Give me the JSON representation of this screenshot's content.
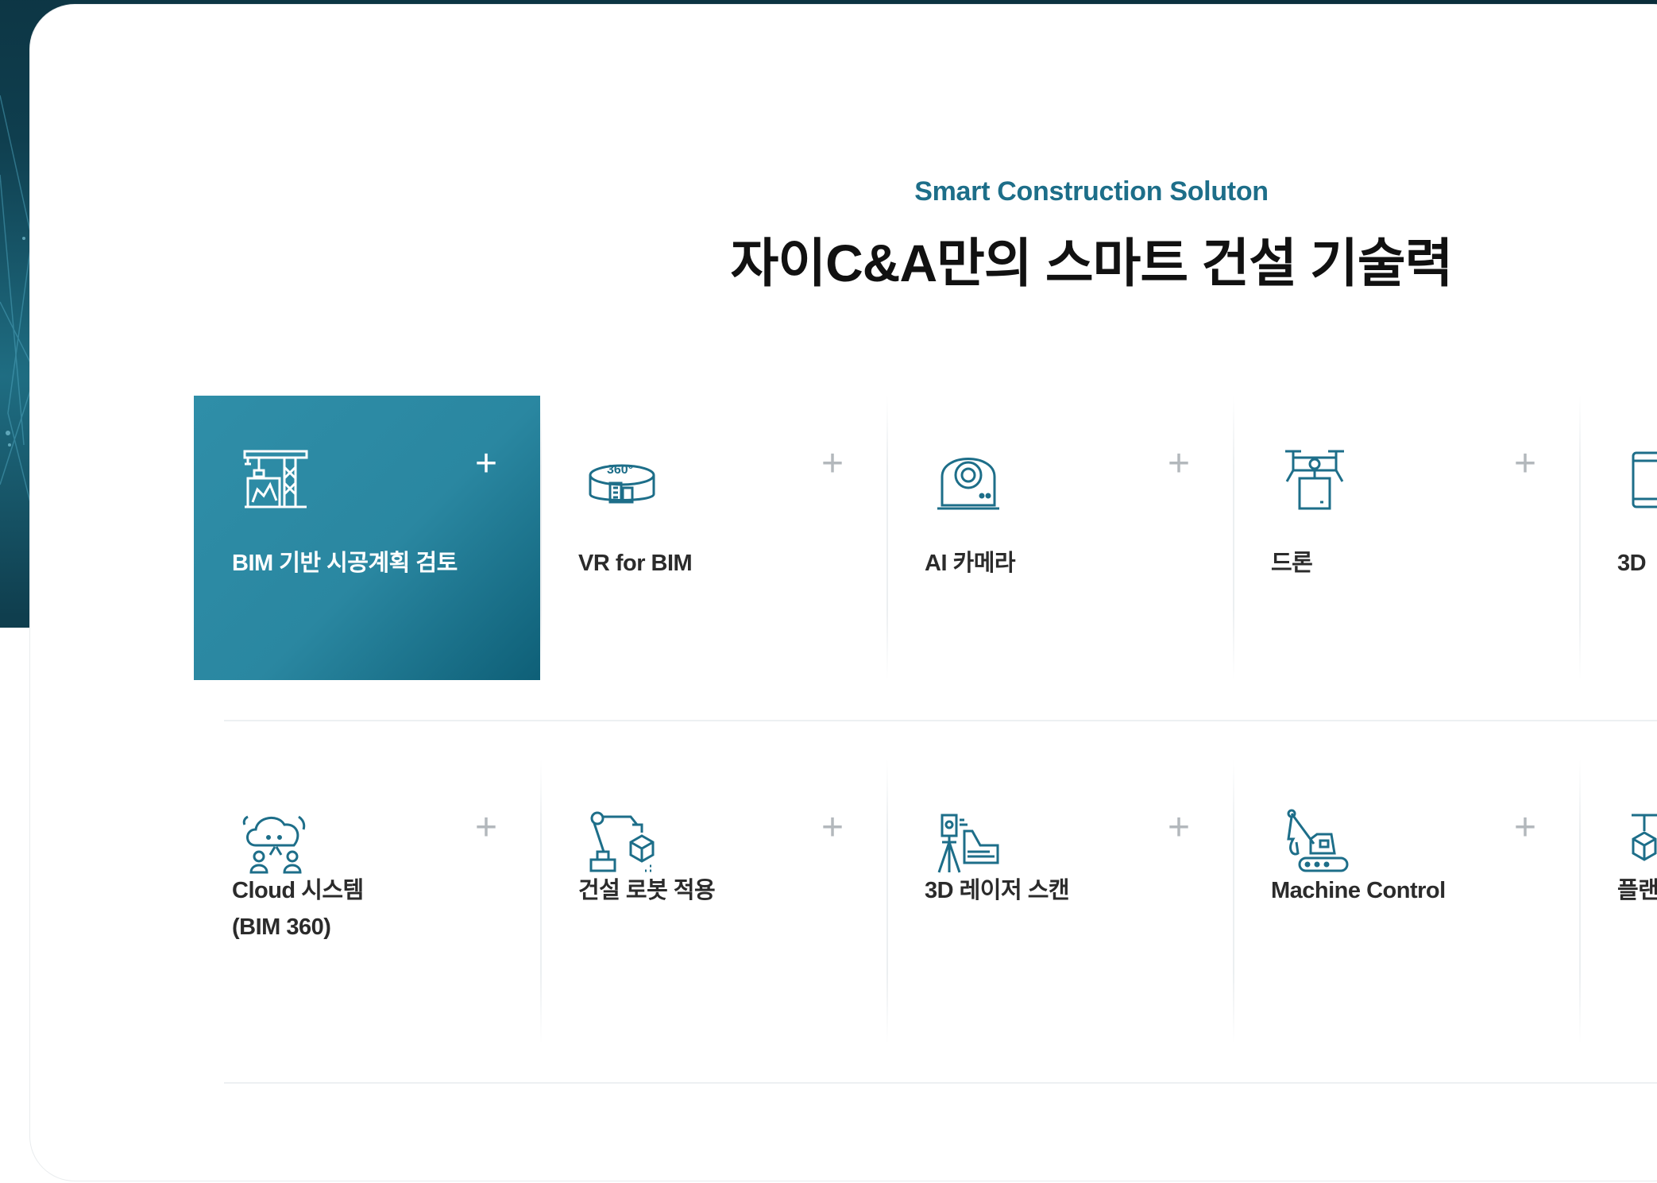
{
  "header": {
    "subtitle": "Smart Construction Soluton",
    "title": "자이C&A만의 스마트 건설 기술력"
  },
  "colors": {
    "accent": "#1d6e89",
    "active_card": "#2a87a1",
    "backdrop": "#0f3e4e"
  },
  "cards": [
    {
      "label": "BIM 기반 시공계획 검토",
      "icon": "crane-icon",
      "active": true
    },
    {
      "label": "VR for BIM",
      "icon": "vr-360-icon",
      "active": false
    },
    {
      "label": "AI 카메라",
      "icon": "camera-icon",
      "active": false
    },
    {
      "label": "드론",
      "icon": "drone-icon",
      "active": false
    },
    {
      "label": "3D",
      "icon": "tablet-icon",
      "active": false
    },
    {
      "label": "Cloud 시스템\n(BIM 360)",
      "icon": "cloud-icon",
      "active": false
    },
    {
      "label": "건설 로봇 적용",
      "icon": "robot-arm-icon",
      "active": false
    },
    {
      "label": "3D 레이저 스캔",
      "icon": "laser-scanner-icon",
      "active": false
    },
    {
      "label": "Machine Control",
      "icon": "excavator-icon",
      "active": false
    },
    {
      "label": "플랜",
      "icon": "plant-icon",
      "active": false
    }
  ],
  "plus_symbol": "+"
}
